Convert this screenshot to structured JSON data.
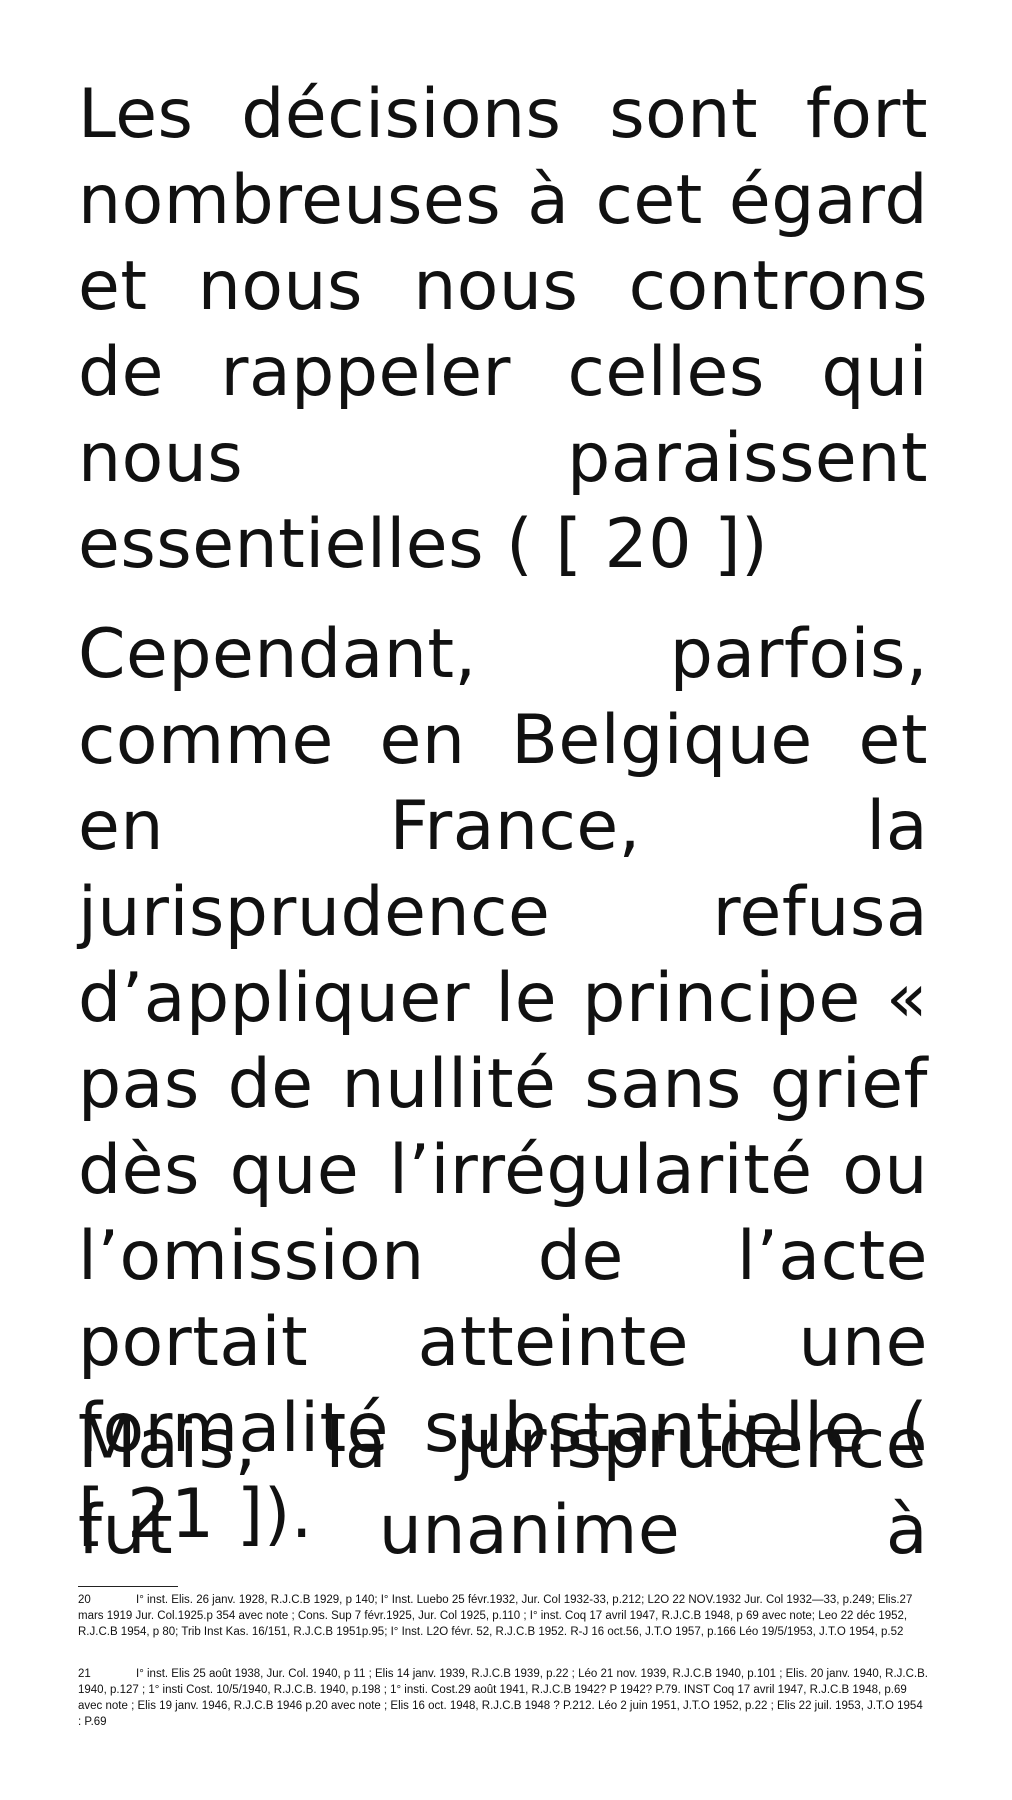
{
  "document": {
    "paragraphs": [
      "Les décisions sont fort nombreuses à cet égard et nous nous controns de rappeler celles qui nous paraissent essentielles ( [ 20 ])",
      "Cependant, parfois, comme en Belgique et en France, la jurisprudence refusa d’appliquer le principe « pas de nullité sans grief dès que l’irrégularité ou l’omission de l’acte portait atteinte une formalité substantielle ( [ 21 ]).",
      "Mais, la jurisprudence fut unanime à prononcer la"
    ],
    "footnotes": [
      {
        "number": "20",
        "text": "I° inst. Elis. 26 janv. 1928, R.J.C.B 1929, p 140; I° Inst. Luebo 25 févr.1932, Jur. Col 1932-33, p.212; L2O 22 NOV.1932 Jur. Col 1932—33, p.249; Elis.27 mars 1919 Jur. Col.1925.p 354 avec note ; Cons. Sup 7 févr.1925, Jur. Col 1925, p.110 ; I° inst. Coq 17 avril 1947, R.J.C.B 1948, p 69 avec note; Leo 22 déc 1952, R.J.C.B 1954, p 80; Trib Inst Kas. 16/151, R.J.C.B 1951p.95; I° Inst. L2O févr. 52, R.J.C.B 1952. R-J 16 oct.56, J.T.O 1957, p.166 Léo 19/5/1953, J.T.O 1954, p.52"
      },
      {
        "number": "21",
        "text": "I° inst. Elis 25 août 1938, Jur. Col. 1940, p 11 ; Elis 14 janv. 1939, R.J.C.B 1939, p.22 ; Léo 21 nov. 1939, R.J.C.B 1940, p.101 ; Elis. 20 janv. 1940, R.J.C.B. 1940, p.127 ; 1° insti Cost. 10/5/1940, R.J.C.B. 1940, p.198 ; 1° insti. Cost.29 août 1941, R.J.C.B 1942? P 1942? P.79. INST Coq 17 avril 1947, R.J.C.B 1948, p.69 avec note ; Elis 19 janv. 1946, R.J.C.B 1946 p.20 avec note ; Elis 16  oct. 1948, R.J.C.B 1948 ? P.212. Léo 2 juin 1951, J.T.O 1952, p.22 ; Elis 22 juil. 1953, J.T.O 1954 : P.69"
      }
    ]
  }
}
